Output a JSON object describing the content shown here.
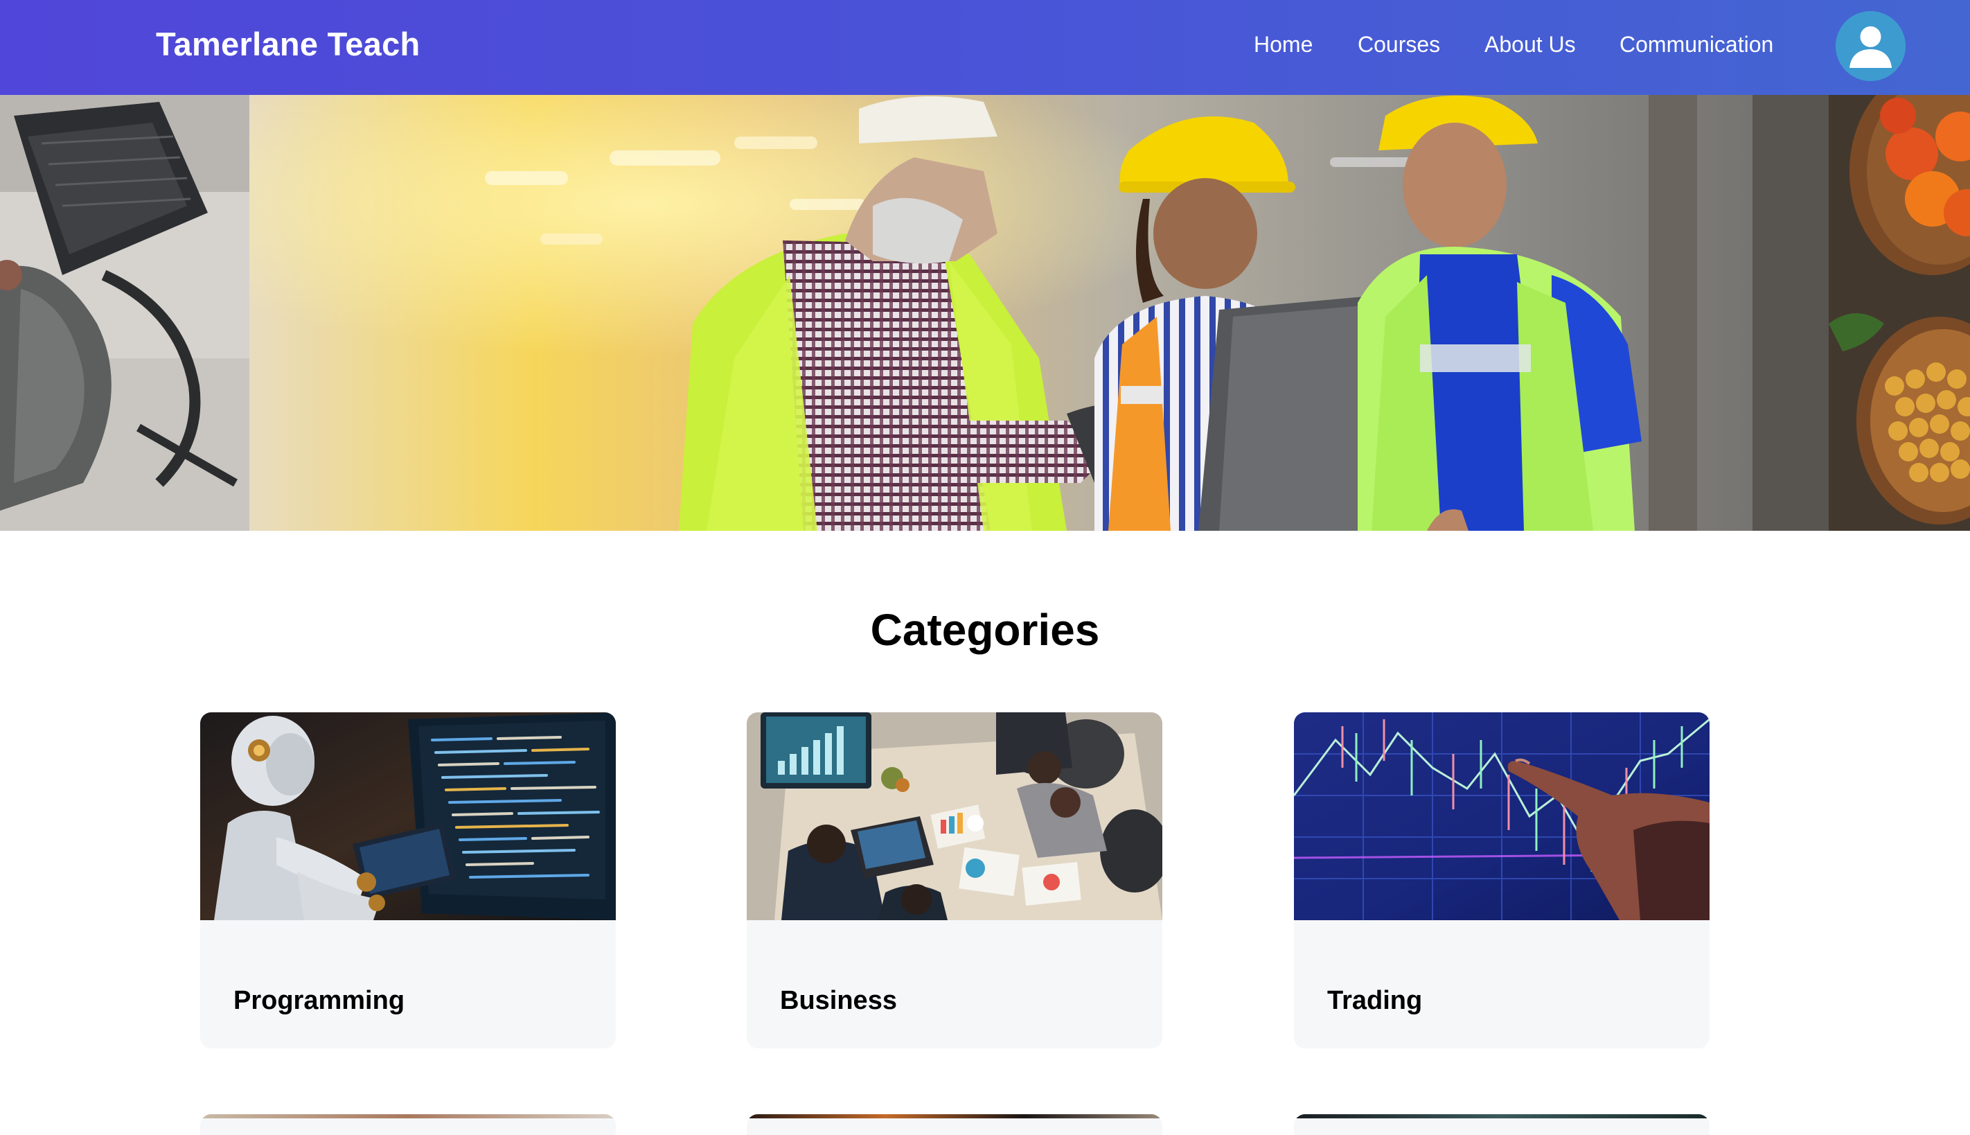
{
  "header": {
    "brand": "Tamerlane Teach",
    "nav": {
      "home": "Home",
      "courses": "Courses",
      "about": "About Us",
      "communication": "Communication"
    },
    "avatar_icon": "user-avatar-icon",
    "gradient_start": "#5046d9",
    "gradient_end": "#4466d2"
  },
  "hero": {
    "slides": [
      {
        "name": "office-chair-slide"
      },
      {
        "name": "factory-workers-laptop-slide"
      },
      {
        "name": "vegetables-bowls-slide"
      }
    ]
  },
  "categories": {
    "title": "Categories",
    "items": [
      {
        "label": "Programming",
        "image": "robot-coding-image"
      },
      {
        "label": "Business",
        "image": "business-meeting-image"
      },
      {
        "label": "Trading",
        "image": "stock-chart-image"
      }
    ]
  }
}
